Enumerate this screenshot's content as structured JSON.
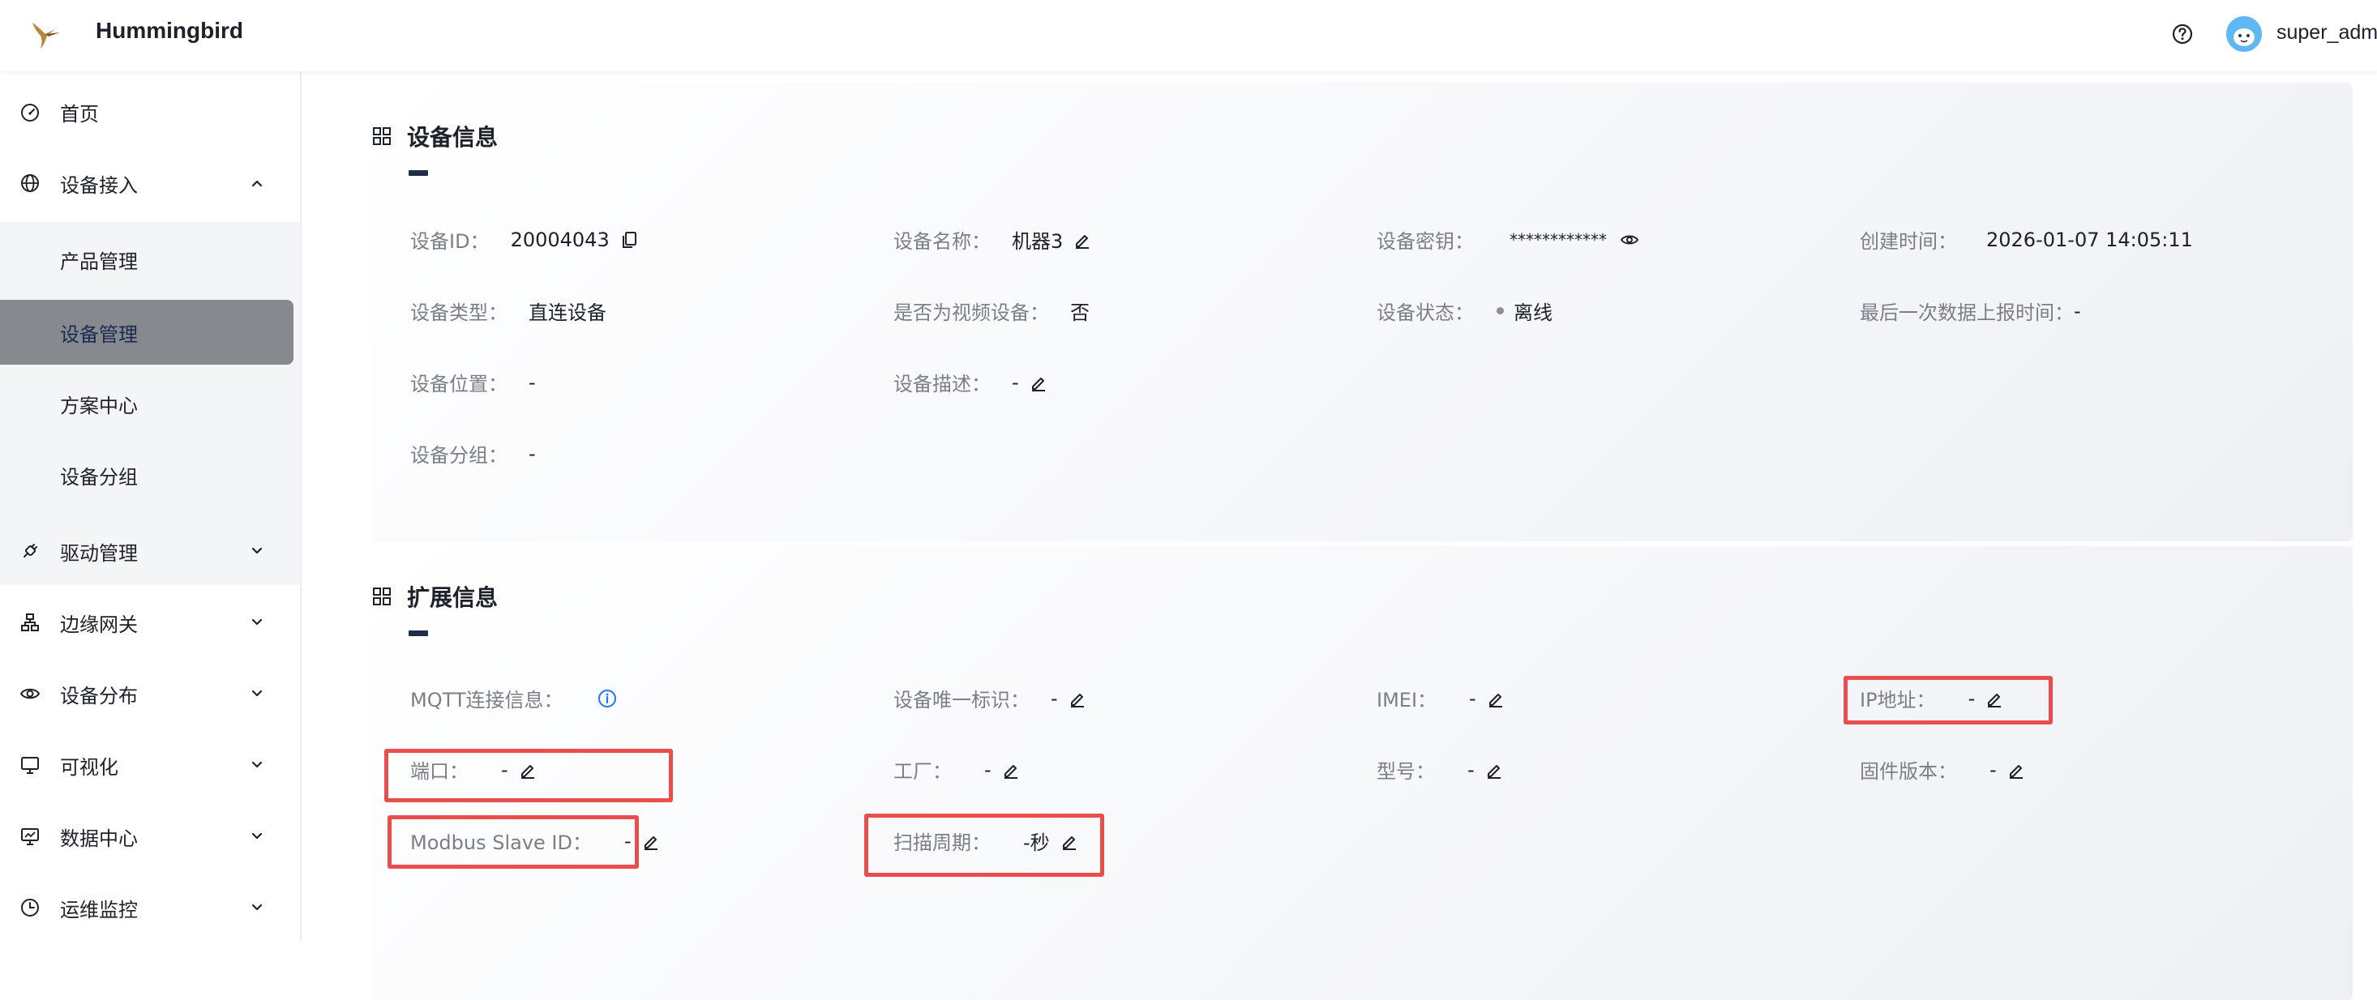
{
  "header": {
    "app_title": "Hummingbird",
    "user_name": "super_adm"
  },
  "sidebar": {
    "items": [
      {
        "label": "首页",
        "icon": "dashboard-icon"
      },
      {
        "label": "设备接入",
        "icon": "globe-icon",
        "expanded": true
      },
      {
        "label": "驱动管理",
        "icon": "plug-icon"
      },
      {
        "label": "边缘网关",
        "icon": "network-icon"
      },
      {
        "label": "设备分布",
        "icon": "eye-icon"
      },
      {
        "label": "可视化",
        "icon": "monitor-icon"
      },
      {
        "label": "数据中心",
        "icon": "chart-monitor-icon"
      },
      {
        "label": "运维监控",
        "icon": "clock-icon"
      }
    ],
    "submenu": [
      {
        "label": "产品管理"
      },
      {
        "label": "设备管理",
        "active": true
      },
      {
        "label": "方案中心"
      },
      {
        "label": "设备分组"
      }
    ]
  },
  "device_info": {
    "title": "设备信息",
    "device_id_label": "设备ID：",
    "device_id": "20004043",
    "name_label": "设备名称：",
    "name": "机器3",
    "secret_label": "设备密钥：",
    "secret": "************",
    "created_label": "创建时间：",
    "created": "2026-01-07 14:05:11",
    "type_label": "设备类型：",
    "type": "直连设备",
    "video_label": "是否为视频设备：",
    "video": "否",
    "status_label": "设备状态：",
    "status": "离线",
    "last_report_label": "最后一次数据上报时间：",
    "last_report": "-",
    "location_label": "设备位置：",
    "location": "-",
    "desc_label": "设备描述：",
    "desc": "-",
    "group_label": "设备分组：",
    "group": "-"
  },
  "ext_info": {
    "title": "扩展信息",
    "mqtt_label": "MQTT连接信息：",
    "uid_label": "设备唯一标识：",
    "uid": "-",
    "imei_label": "IMEI：",
    "imei": "-",
    "ip_label": "IP地址：",
    "ip": "-",
    "port_label": "端口：",
    "port": "-",
    "factory_label": "工厂：",
    "factory": "-",
    "model_label": "型号：",
    "model": "-",
    "firmware_label": "固件版本：",
    "firmware": "-",
    "slave_label": "Modbus Slave ID：",
    "slave": "-",
    "scan_label": "扫描周期：",
    "scan": "-秒"
  },
  "colors": {
    "highlight": "#e94e4e",
    "active_menu": "#86898e",
    "title_accent": "#1f2d4d",
    "info_blue": "#1677ff"
  }
}
